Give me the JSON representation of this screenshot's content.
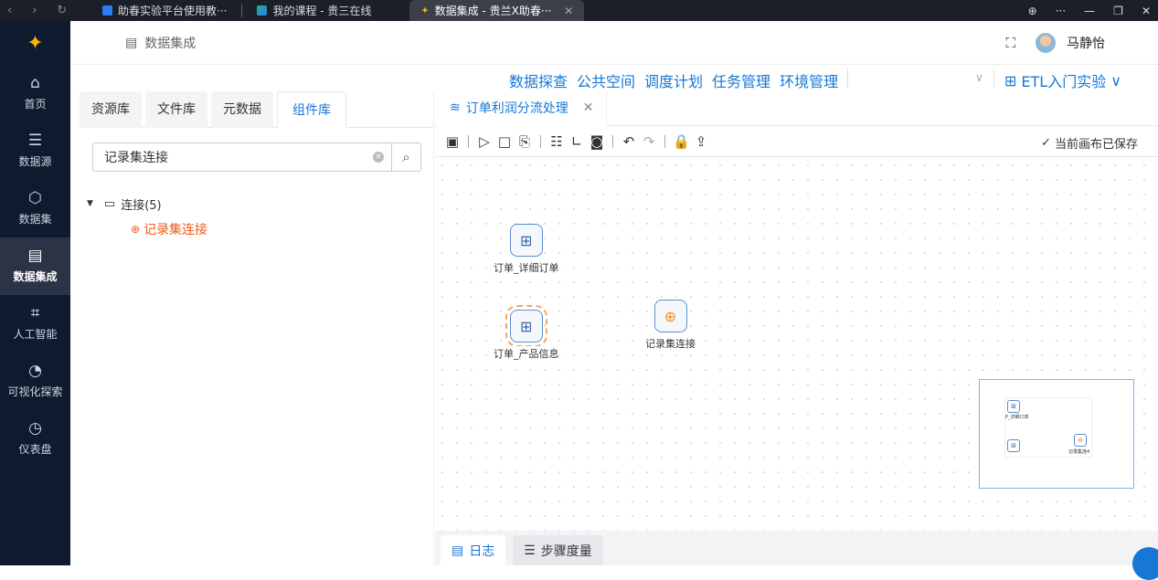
{
  "browser": {
    "tabs": [
      {
        "title": "助春实验平台使用教···",
        "favicon": "doc-icon"
      },
      {
        "title": "我的课程 - 贵三在线",
        "favicon": "layers-icon"
      },
      {
        "title": "数据集成 - 贵兰X助春···",
        "favicon": "sparkle-icon",
        "active": true
      }
    ]
  },
  "sidebar": {
    "items": [
      {
        "label": "首页",
        "icon": "home-icon"
      },
      {
        "label": "数据源",
        "icon": "database-icon"
      },
      {
        "label": "数据集",
        "icon": "cube-icon"
      },
      {
        "label": "数据集成",
        "icon": "server-icon",
        "active": true
      },
      {
        "label": "人工智能",
        "icon": "ai-icon"
      },
      {
        "label": "可视化探索",
        "icon": "pie-chart-icon"
      },
      {
        "label": "仪表盘",
        "icon": "gauge-icon"
      }
    ]
  },
  "header": {
    "breadcrumb": "数据集成",
    "user_name": "马静怡"
  },
  "topmenu": {
    "items": [
      "数据探查",
      "公共空间",
      "调度计划",
      "任务管理",
      "环境管理"
    ],
    "project": "ETL入门实验"
  },
  "left_panel": {
    "tabs": [
      "资源库",
      "文件库",
      "元数据",
      "组件库"
    ],
    "active_tab": "组件库",
    "search_value": "记录集连接",
    "tree": {
      "folder": "连接(5)",
      "child": "记录集连接"
    }
  },
  "editor": {
    "tab_title": "订单利润分流处理",
    "saved_status": "当前画布已保存",
    "nodes": [
      {
        "label": "订单_详细订单"
      },
      {
        "label": "订单_产品信息"
      },
      {
        "label": "记录集连接"
      }
    ],
    "minimap_labels": [
      "P_详细订单",
      "记录集连4"
    ],
    "bottom_tabs": [
      "日志",
      "步骤度量"
    ]
  },
  "colors": {
    "accent": "#1677d6",
    "sidebar_bg": "#0e1a2e",
    "highlight": "#f05a1a"
  }
}
